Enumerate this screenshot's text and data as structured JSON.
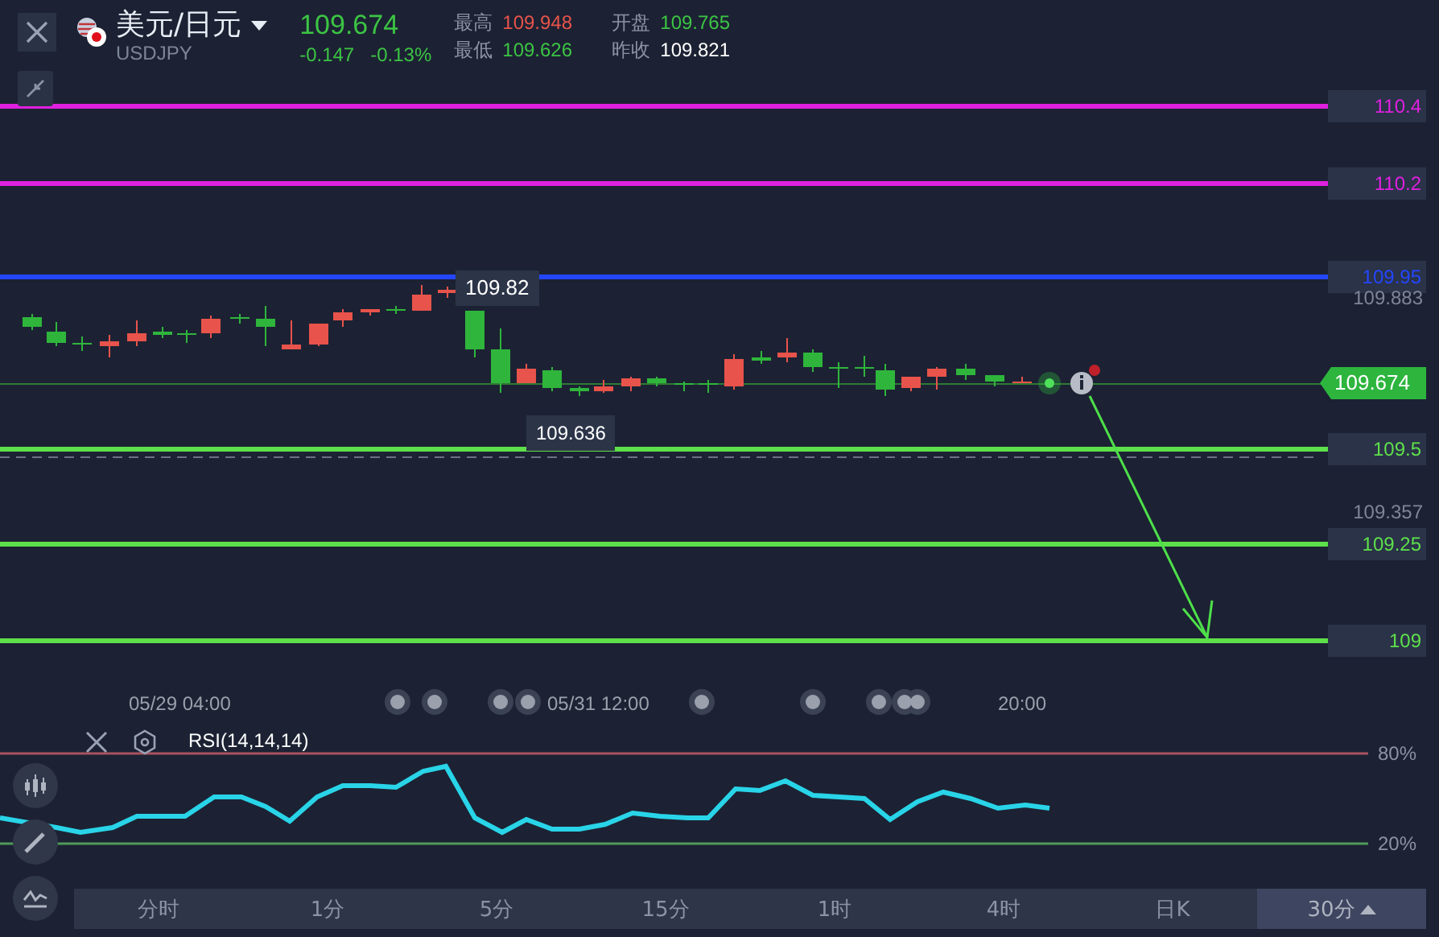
{
  "header": {
    "title": "美元/日元",
    "symbol": "USDJPY",
    "price": "109.674",
    "change": "-0.147",
    "change_pct": "-0.13%",
    "stats": [
      {
        "label": "最高",
        "value": "109.948",
        "color": "#e8534b"
      },
      {
        "label": "开盘",
        "value": "109.765",
        "color": "#3cc444"
      },
      {
        "label": "最低",
        "value": "109.626",
        "color": "#3cc444"
      },
      {
        "label": "昨收",
        "value": "109.821",
        "color": "#ffffff"
      }
    ]
  },
  "chart": {
    "levels": [
      {
        "label": "110.4",
        "color": "#e020e0"
      },
      {
        "label": "110.2",
        "color": "#e020e0"
      },
      {
        "label": "109.95",
        "color": "#2446ff"
      },
      {
        "label": "109.5",
        "color": "#5ee04a"
      },
      {
        "label": "109.25",
        "color": "#5ee04a"
      },
      {
        "label": "109",
        "color": "#5ee04a"
      }
    ],
    "axis_labels": [
      "109.883",
      "109.357"
    ],
    "current_price": "109.674",
    "high_tooltip": "109.82",
    "low_tooltip": "109.636",
    "time_labels": [
      "05/29 04:00",
      "05/31 12:00",
      "20:00"
    ]
  },
  "rsi": {
    "label": "RSI(14,14,14)",
    "upper": "80%",
    "lower": "20%"
  },
  "tabs": [
    {
      "label": "分时",
      "selected": false
    },
    {
      "label": "1分",
      "selected": false
    },
    {
      "label": "5分",
      "selected": false
    },
    {
      "label": "15分",
      "selected": false
    },
    {
      "label": "1时",
      "selected": false
    },
    {
      "label": "4时",
      "selected": false
    },
    {
      "label": "日K",
      "selected": false
    },
    {
      "label": "30分",
      "selected": true
    }
  ]
}
